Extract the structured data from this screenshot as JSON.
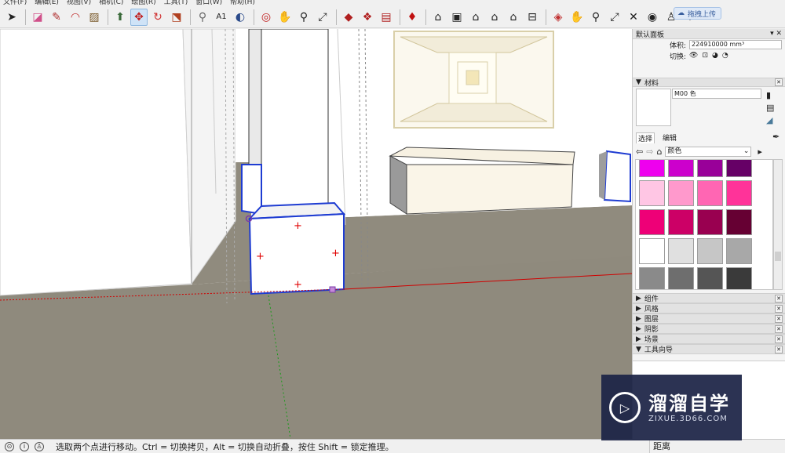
{
  "menu": [
    "文件(F)",
    "编辑(E)",
    "视图(V)",
    "相机(C)",
    "绘图(R)",
    "工具(T)",
    "窗口(W)",
    "帮助(H)"
  ],
  "toolbar": {
    "upload_label": "拖拽上传",
    "icons": [
      "select-icon",
      "eraser-icon",
      "pencil-icon",
      "arc-icon",
      "rectangle-icon",
      "push-pull-icon",
      "move-icon",
      "rotate-icon",
      "scale-icon",
      "tape-measure-icon",
      "text-icon",
      "paint-bucket-icon",
      "orbit-icon",
      "pan-icon",
      "zoom-icon",
      "zoom-extents-icon",
      "warehouse-icon",
      "extension-icon",
      "layout-icon",
      "ruby-icon",
      "iso-view-icon",
      "top-view-icon",
      "front-view-icon",
      "right-view-icon",
      "back-view-icon",
      "left-view-icon",
      "section-plane-icon",
      "section-display-icon",
      "position-camera-icon",
      "walk-icon",
      "look-around-icon",
      "footprints-icon"
    ]
  },
  "panel": {
    "title": "默认面板",
    "volume_label": "体积:",
    "volume_value": "224910000 mm³",
    "toggle_label": "切换:",
    "materials": {
      "header": "材料",
      "name": "M00 色",
      "tabs": [
        "选择",
        "编辑"
      ],
      "collection": "颜色",
      "swatches": [
        [
          "#ee00ee",
          "#cc00cc",
          "#990099",
          "#660066"
        ],
        [
          "#ffc6e4",
          "#ff99cc",
          "#ff66b3",
          "#ff3399"
        ],
        [
          "#ee0077",
          "#cc0066",
          "#990050",
          "#660033"
        ],
        [
          "#ffffff",
          "#e0e0e0",
          "#c6c6c6",
          "#a8a8a8"
        ],
        [
          "#8a8a8a",
          "#6e6e6e",
          "#555555",
          "#3a3a3a"
        ]
      ]
    },
    "collapsed_sections": [
      "组件",
      "风格",
      "图层",
      "阴影",
      "场景"
    ],
    "expanded_section": "工具向导"
  },
  "status": {
    "text": "选取两个点进行移动。Ctrl = 切换拷贝，Alt = 切换自动折叠，按住 Shift = 锁定推理。",
    "measure_label": "距离"
  },
  "watermark": {
    "title": "溜溜自学",
    "subtitle": "ZIXUE.3D66.COM"
  },
  "colors": {
    "ground": "#8f8a7d",
    "selection": "#1e3cd2",
    "axis_red": "#d00000",
    "axis_green": "#1a9a1a"
  }
}
